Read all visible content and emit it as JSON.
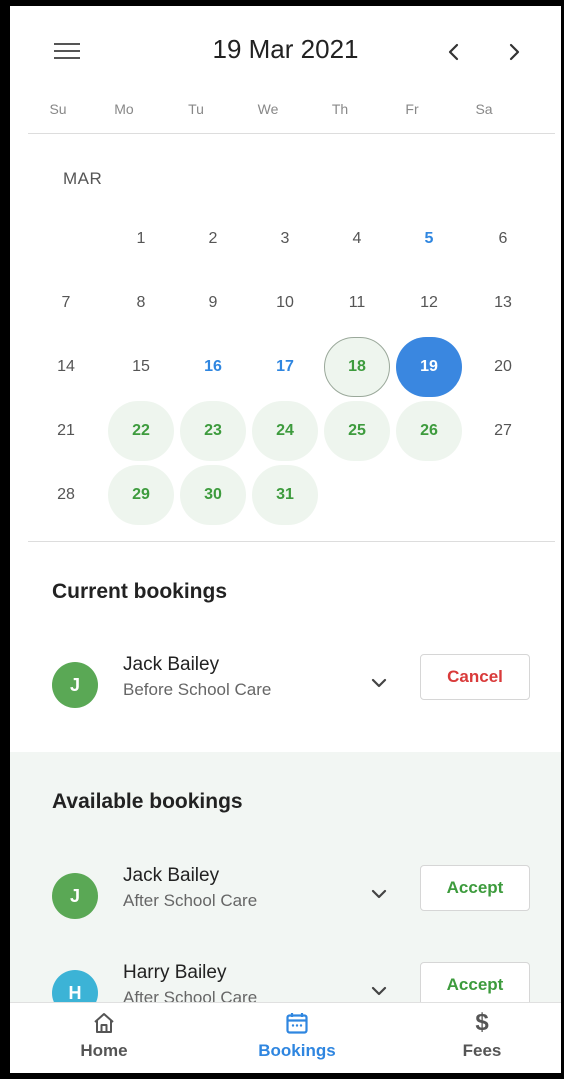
{
  "header": {
    "title": "19 Mar 2021",
    "menu_icon": "menu-icon",
    "prev_icon": "chevron-left-icon",
    "next_icon": "chevron-right-icon"
  },
  "weekdays": [
    "Su",
    "Mo",
    "Tu",
    "We",
    "Th",
    "Fr",
    "Sa"
  ],
  "calendar": {
    "month_label": "MAR",
    "weeks": [
      [
        "",
        "1",
        "2",
        "3",
        "4",
        "5",
        "6"
      ],
      [
        "7",
        "8",
        "9",
        "10",
        "11",
        "12",
        "13"
      ],
      [
        "14",
        "15",
        "16",
        "17",
        "18",
        "19",
        "20"
      ],
      [
        "21",
        "22",
        "23",
        "24",
        "25",
        "26",
        "27"
      ],
      [
        "28",
        "29",
        "30",
        "31",
        "",
        "",
        ""
      ]
    ],
    "highlighted_blue": [
      "5",
      "16",
      "17"
    ],
    "booked_green": [
      "22",
      "23",
      "24",
      "25",
      "26",
      "29",
      "30",
      "31"
    ],
    "today": "18",
    "selected": "19"
  },
  "current": {
    "title": "Current bookings",
    "items": [
      {
        "initial": "J",
        "name": "Jack Bailey",
        "care": "Before School Care",
        "action": "Cancel",
        "avatar_color": "#5aa855"
      }
    ]
  },
  "available": {
    "title": "Available bookings",
    "items": [
      {
        "initial": "J",
        "name": "Jack Bailey",
        "care": "After School Care",
        "action": "Accept",
        "avatar_color": "#5aa855"
      },
      {
        "initial": "H",
        "name": "Harry Bailey",
        "care": "After School Care",
        "action": "Accept",
        "avatar_color": "#3cb3d6"
      }
    ]
  },
  "bottom_nav": [
    {
      "label": "Home",
      "icon": "home-icon",
      "active": false
    },
    {
      "label": "Bookings",
      "icon": "calendar-icon",
      "active": true
    },
    {
      "label": "Fees",
      "icon": "dollar-icon",
      "active": false
    }
  ],
  "colors": {
    "accent_blue": "#3a87e0",
    "green": "#3d9b3d",
    "cancel_red": "#d93a3a"
  }
}
